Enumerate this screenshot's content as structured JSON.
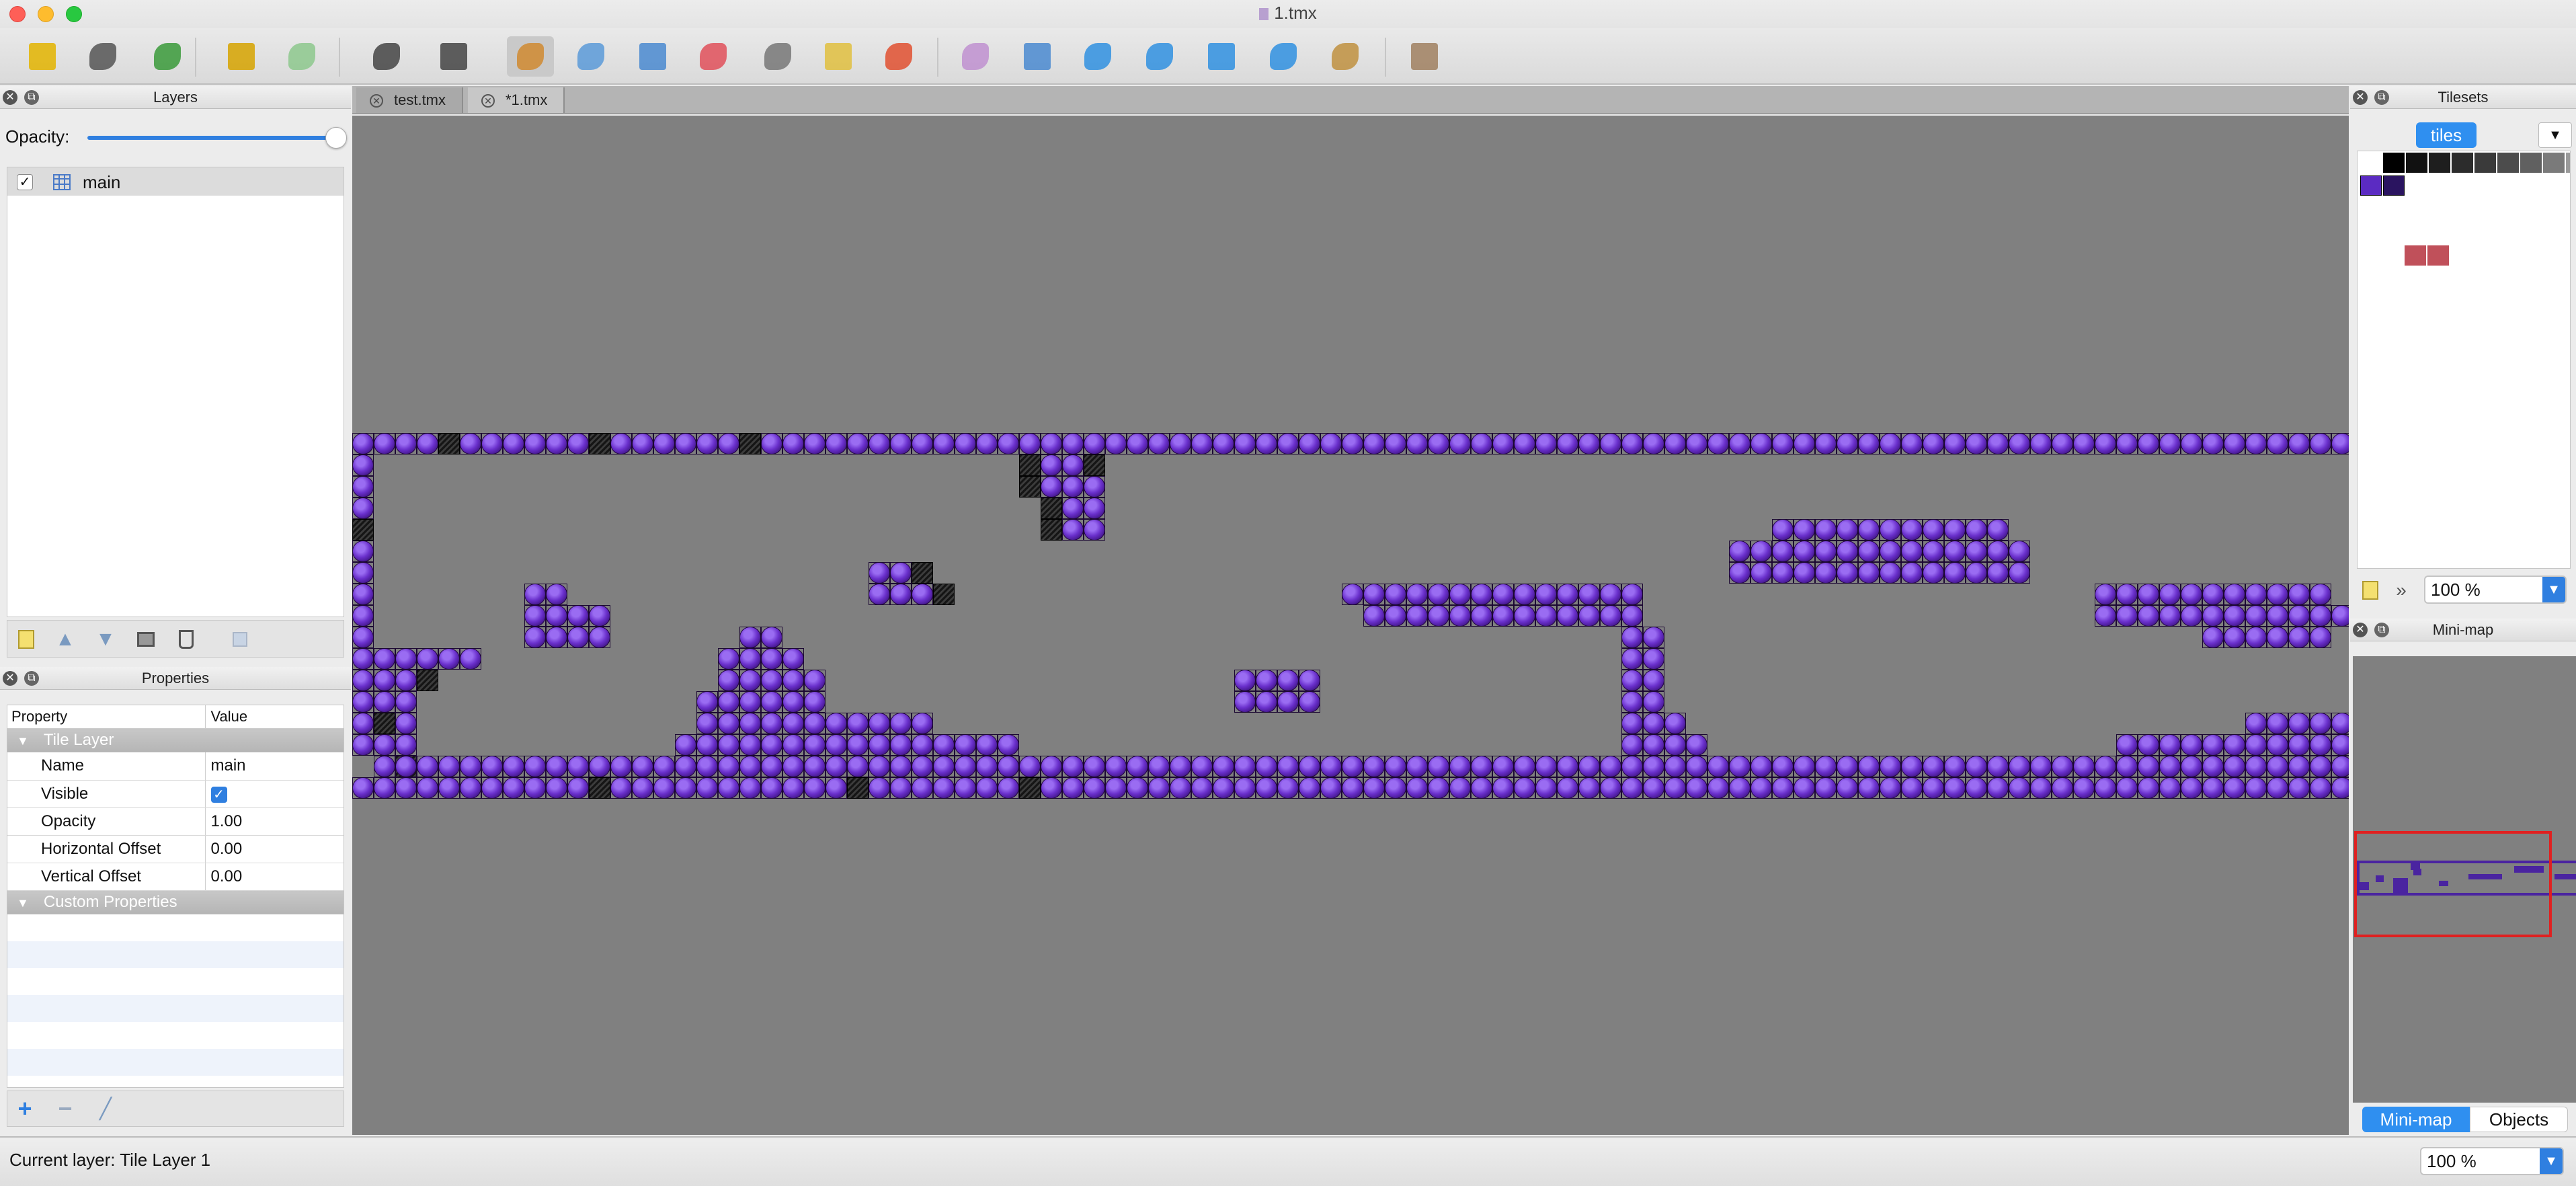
{
  "window": {
    "title": "1.tmx",
    "file_icon": "tmx-file-icon"
  },
  "toolbar": {
    "buttons": [
      {
        "name": "new-file-icon",
        "color": "#e3b400"
      },
      {
        "name": "open-file-icon",
        "color": "#555555"
      },
      {
        "name": "save-file-icon",
        "color": "#3a9a3a"
      },
      {
        "name": "undo-icon",
        "color": "#d6a300"
      },
      {
        "name": "redo-icon",
        "color": "#8dc88d"
      },
      {
        "name": "random-mode-icon",
        "color": "#444444"
      },
      {
        "name": "dice-icon",
        "color": "#444444"
      },
      {
        "name": "stamp-brush-icon",
        "color": "#d08a30"
      },
      {
        "name": "terrain-brush-icon",
        "color": "#5a9ad8"
      },
      {
        "name": "bucket-fill-icon",
        "color": "#4a8ad0"
      },
      {
        "name": "eraser-icon",
        "color": "#e0505a"
      },
      {
        "name": "rect-select-icon",
        "color": "#777777"
      },
      {
        "name": "magic-wand-icon",
        "color": "#e0c040"
      },
      {
        "name": "select-same-tile-icon",
        "color": "#e05030"
      },
      {
        "name": "select-objects-icon",
        "color": "#c090d0"
      },
      {
        "name": "edit-polygons-icon",
        "color": "#4a8ad0"
      },
      {
        "name": "insert-rectangle-icon",
        "color": "#3090e0"
      },
      {
        "name": "insert-ellipse-icon",
        "color": "#3090e0"
      },
      {
        "name": "insert-polygon-icon",
        "color": "#3090e0"
      },
      {
        "name": "insert-polyline-icon",
        "color": "#3090e0"
      },
      {
        "name": "insert-tile-icon",
        "color": "#c09040"
      },
      {
        "name": "show-objects-icon",
        "color": "#a08060"
      }
    ]
  },
  "layers_panel": {
    "title": "Layers",
    "opacity_label": "Opacity:",
    "opacity_value": 1.0,
    "layers": [
      {
        "name": "main",
        "visible": true,
        "icon": "tile-layer-icon"
      }
    ]
  },
  "properties_panel": {
    "title": "Properties",
    "columns": [
      "Property",
      "Value"
    ],
    "group": "Tile Layer",
    "rows": [
      {
        "key": "Name",
        "value": "main"
      },
      {
        "key": "Visible",
        "value": ""
      },
      {
        "key": "Opacity",
        "value": "1.00"
      },
      {
        "key": "Horizontal Offset",
        "value": "0.00"
      },
      {
        "key": "Vertical Offset",
        "value": "0.00"
      }
    ],
    "custom_group": "Custom Properties"
  },
  "tabs": [
    {
      "label": "test.tmx",
      "active": false
    },
    {
      "label": "*1.tmx",
      "active": true
    }
  ],
  "tilesets_panel": {
    "title": "Tilesets",
    "active_tab": "tiles",
    "zoom": "100 %"
  },
  "minimap_panel": {
    "title": "Mini-map",
    "tabs": [
      "Mini-map",
      "Objects"
    ],
    "active_tab": "Mini-map"
  },
  "status": {
    "text": "Current layer: Tile Layer 1",
    "zoom": "100 %"
  },
  "colors": {
    "accent": "#2f7fe0",
    "tile_purple": "#5b2bc2",
    "canvas_bg": "#808080",
    "minimap_frame": "#e02020",
    "tileset_red": "#c0505a"
  }
}
